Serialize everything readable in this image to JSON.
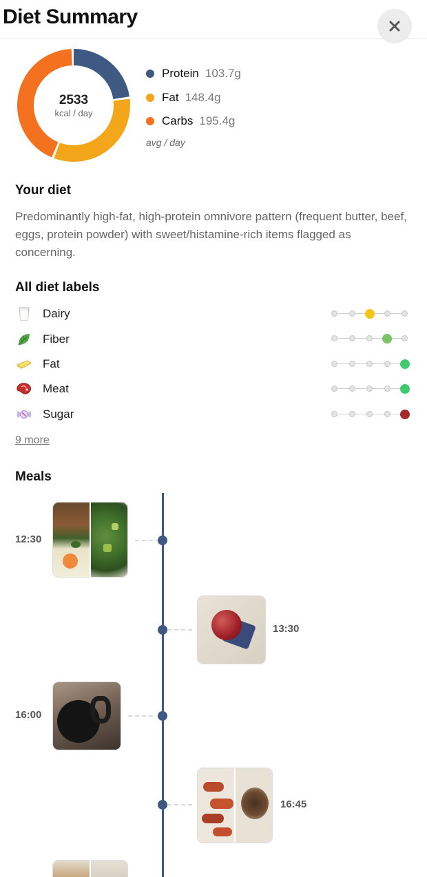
{
  "header": {
    "title": "Diet Summary",
    "close_icon": "close-icon"
  },
  "summary": {
    "kcal": "2533",
    "kcal_unit": "kcal / day",
    "avg_note": "avg / day",
    "macros": [
      {
        "name": "Protein",
        "value": "103.7g",
        "grams": 103.7,
        "color": "#3e5a82"
      },
      {
        "name": "Fat",
        "value": "148.4g",
        "grams": 148.4,
        "color": "#f3a61a"
      },
      {
        "name": "Carbs",
        "value": "195.4g",
        "grams": 195.4,
        "color": "#f4711f"
      }
    ]
  },
  "your_diet": {
    "title": "Your diet",
    "description": "Predominantly high-fat, high-protein omnivore pattern (frequent butter, beef, eggs, protein powder) with sweet/histamine-rich items flagged as concerning."
  },
  "diet_labels": {
    "title": "All diet labels",
    "more_link": "9 more",
    "items": [
      {
        "name": "Dairy",
        "icon": "milk-glass-icon",
        "level": 3,
        "level_color": "#f5c518"
      },
      {
        "name": "Fiber",
        "icon": "leaf-icon",
        "level": 4,
        "level_color": "#7dc462"
      },
      {
        "name": "Fat",
        "icon": "butter-icon",
        "level": 5,
        "level_color": "#3ecb6c"
      },
      {
        "name": "Meat",
        "icon": "steak-icon",
        "level": 5,
        "level_color": "#3ecb6c"
      },
      {
        "name": "Sugar",
        "icon": "candy-icon",
        "level": 5,
        "level_color": "#a3282c"
      }
    ]
  },
  "meals": {
    "title": "Meals",
    "entries": [
      {
        "time": "12:30",
        "side": "left",
        "photos": [
          "food-photo",
          "salad-photo"
        ]
      },
      {
        "time": "13:30",
        "side": "right",
        "photos": [
          "apple-photo"
        ]
      },
      {
        "time": "16:00",
        "side": "left",
        "photos": [
          "mug-photo"
        ]
      },
      {
        "time": "16:45",
        "side": "right",
        "photos": [
          "dates-photo",
          "cookie-photo"
        ]
      },
      {
        "time": "",
        "side": "left",
        "photos": [
          "food-photo",
          "plate-photo"
        ]
      }
    ]
  }
}
